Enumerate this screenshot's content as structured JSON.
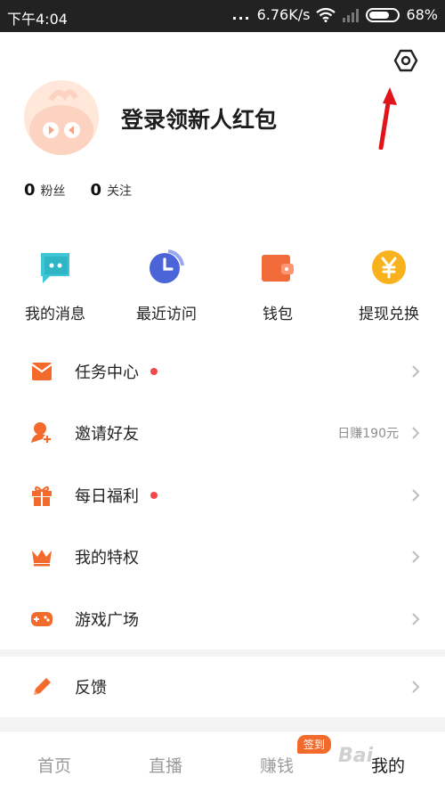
{
  "status_bar": {
    "time": "下午4:04",
    "signal_dots": "...",
    "speed": "6.76K/s",
    "battery": "68%"
  },
  "profile": {
    "login_prompt": "登录领新人红包"
  },
  "follow_stats": [
    {
      "count": "0",
      "label": "粉丝"
    },
    {
      "count": "0",
      "label": "关注"
    }
  ],
  "quick_actions": [
    {
      "label": "我的消息",
      "icon": "chat-icon"
    },
    {
      "label": "最近访问",
      "icon": "clock-icon"
    },
    {
      "label": "钱包",
      "icon": "wallet-icon"
    },
    {
      "label": "提现兑换",
      "icon": "yuan-coin-icon"
    }
  ],
  "menu": [
    {
      "label": "任务中心",
      "icon": "task-envelope-icon",
      "dot": true,
      "extra": ""
    },
    {
      "label": "邀请好友",
      "icon": "invite-user-icon",
      "dot": false,
      "extra": "日赚190元"
    },
    {
      "label": "每日福利",
      "icon": "gift-icon",
      "dot": true,
      "extra": ""
    },
    {
      "label": "我的特权",
      "icon": "crown-icon",
      "dot": false,
      "extra": ""
    },
    {
      "label": "游戏广场",
      "icon": "gamepad-icon",
      "dot": false,
      "extra": ""
    }
  ],
  "feedback": {
    "label": "反馈",
    "icon": "pencil-icon"
  },
  "tabbar": {
    "tabs": [
      "首页",
      "直播",
      "赚钱",
      "我的"
    ],
    "active_index": 3,
    "badge": "签到"
  },
  "watermark": "Bai",
  "colors": {
    "accent": "#f26b2c",
    "dot": "#f24848",
    "annotation": "#e0151b"
  }
}
